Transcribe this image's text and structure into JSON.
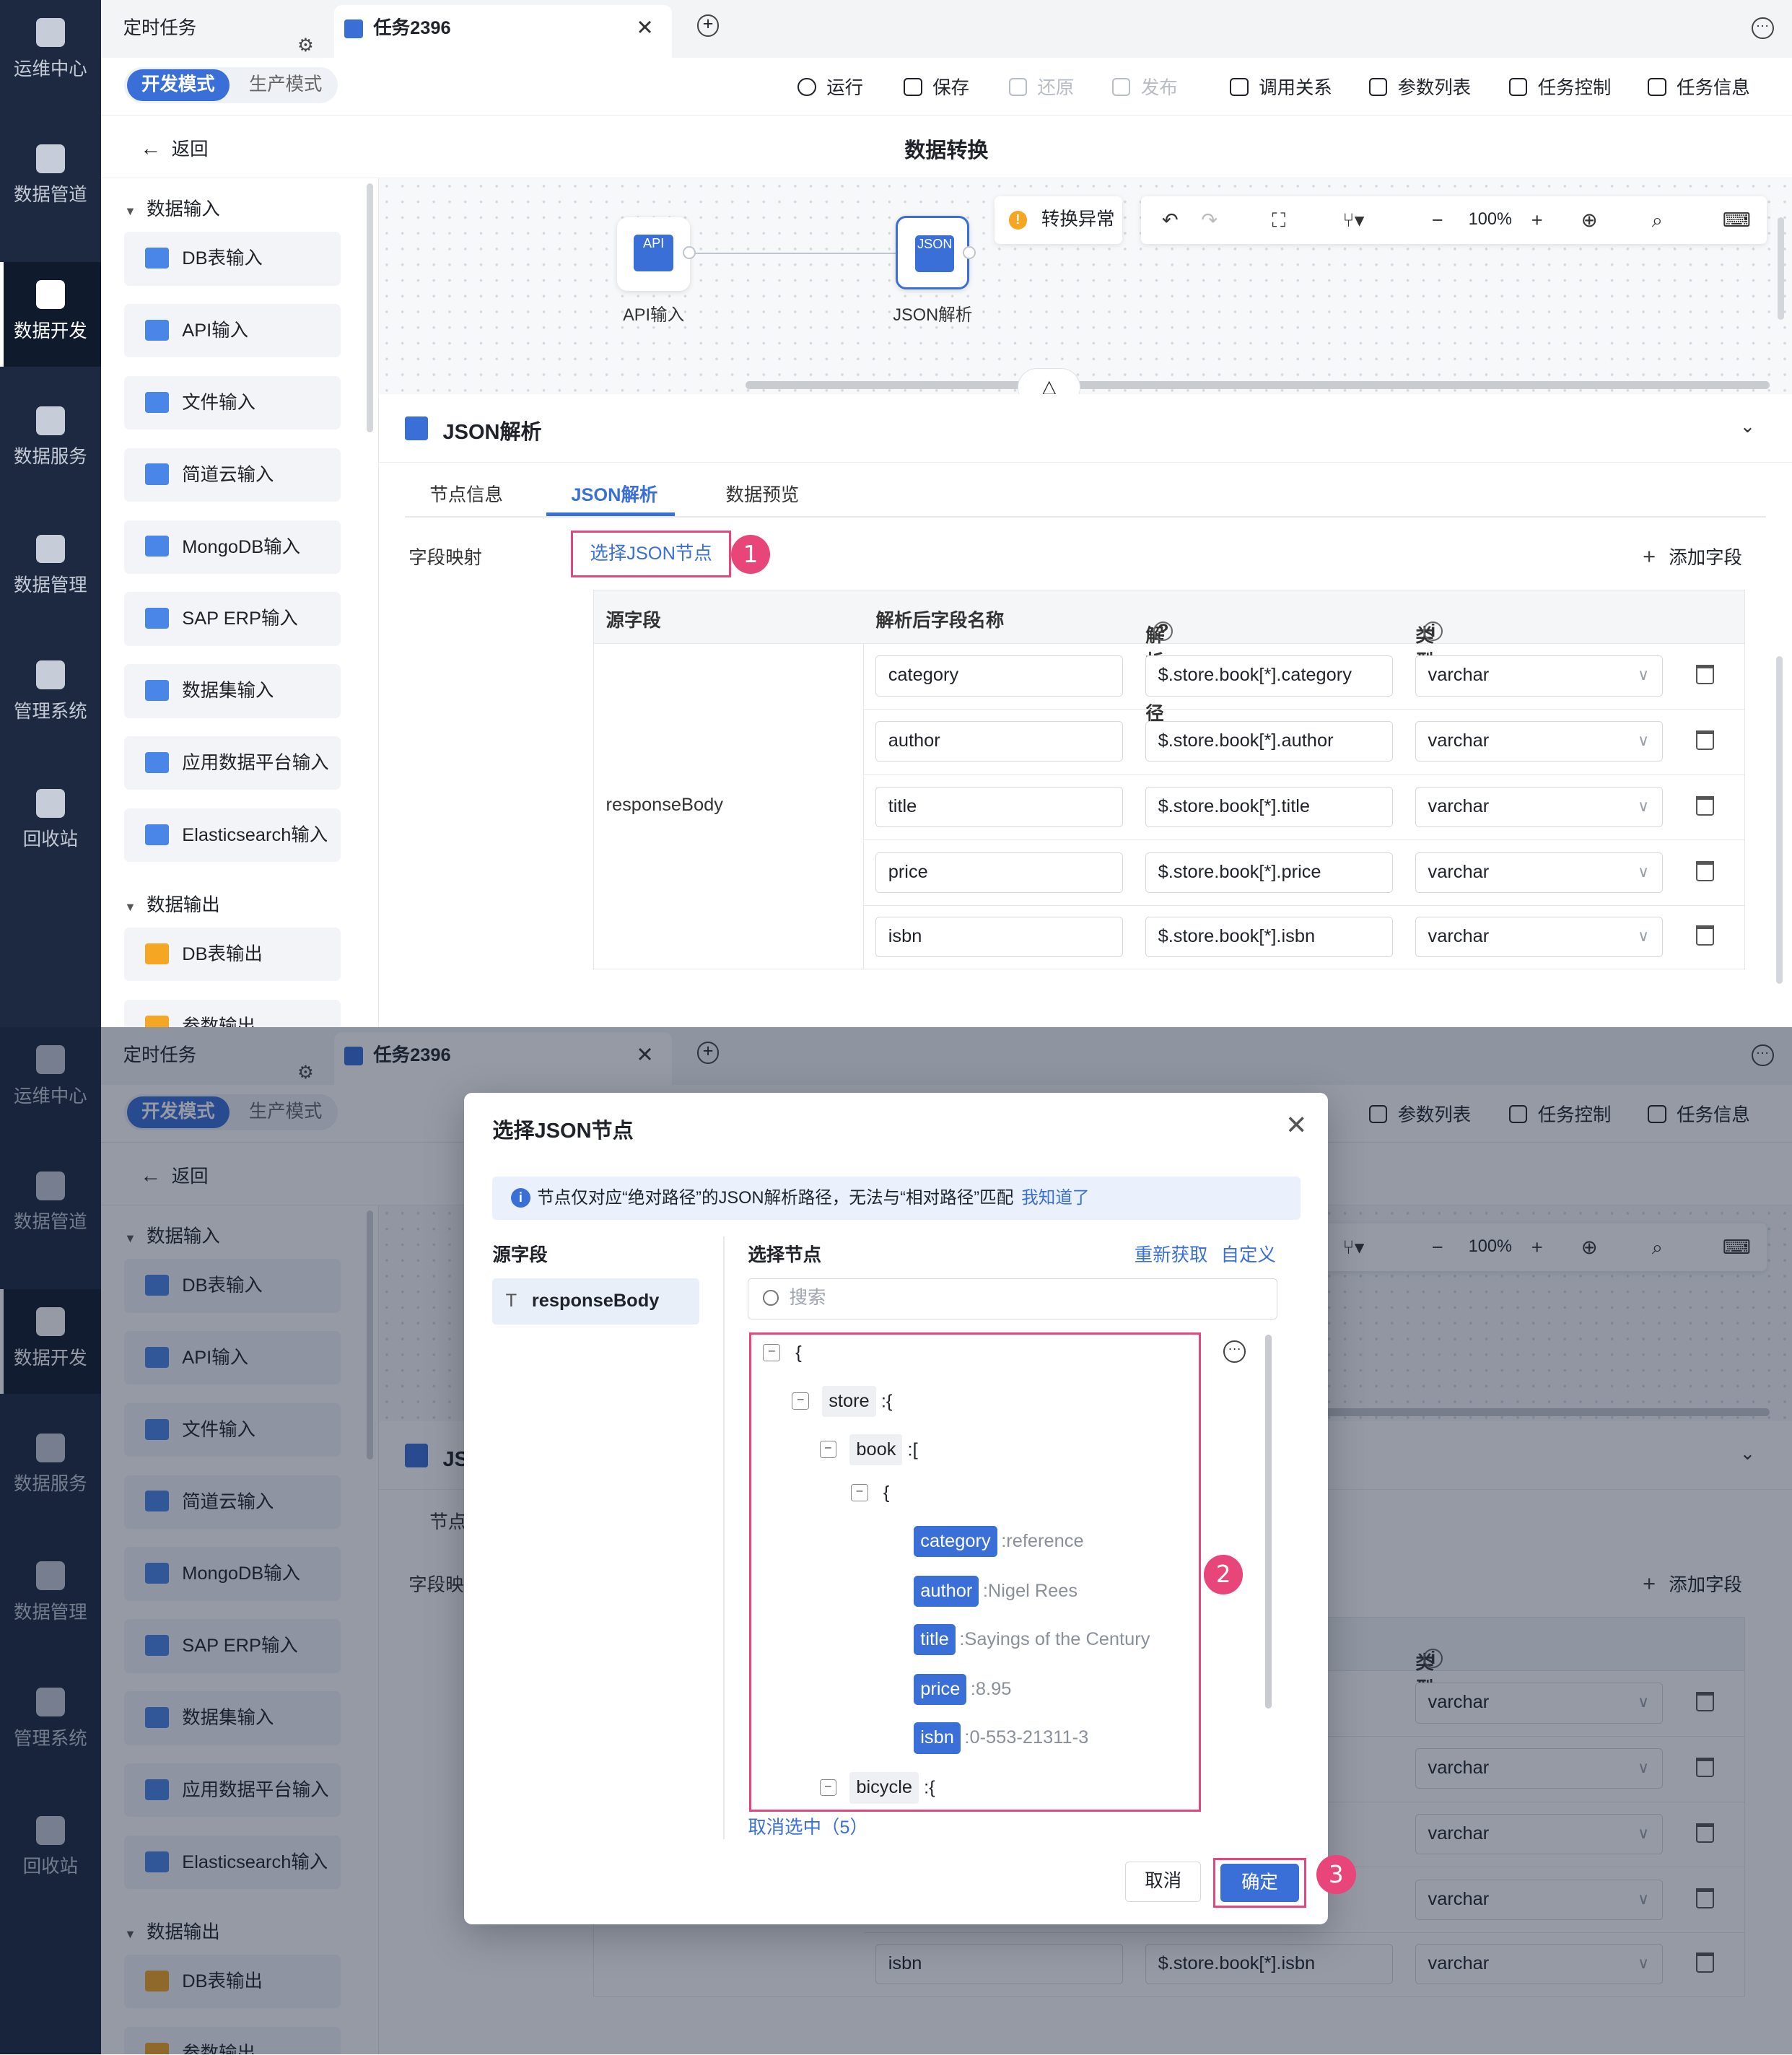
{
  "nav": [
    "运维中心",
    "数据管道",
    "数据开发",
    "数据服务",
    "数据管理",
    "管理系统",
    "回收站"
  ],
  "tabs": {
    "tab1": "定时任务",
    "tab2": "任务2396"
  },
  "mode": {
    "dev": "开发模式",
    "prod": "生产模式"
  },
  "toolbar": {
    "run": "运行",
    "save": "保存",
    "restore": "还原",
    "publish": "发布",
    "relation": "调用关系",
    "params": "参数列表",
    "control": "任务控制",
    "info": "任务信息"
  },
  "back": "返回",
  "page_title": "数据转换",
  "sidebar": {
    "input_group": "数据输入",
    "inputs": [
      "DB表输入",
      "API输入",
      "文件输入",
      "简道云输入",
      "MongoDB输入",
      "SAP ERP输入",
      "数据集输入",
      "应用数据平台输入",
      "Elasticsearch输入"
    ],
    "output_group": "数据输出",
    "outputs": [
      "DB表输出",
      "参数输出"
    ]
  },
  "canvas": {
    "node1": "API输入",
    "node1_icon": "API",
    "node2": "JSON解析",
    "node2_icon": "JSON",
    "warning": "转换异常",
    "zoom": "100%"
  },
  "panel": {
    "title": "JSON解析",
    "tabs": [
      "节点信息",
      "JSON解析",
      "数据预览"
    ],
    "field_mapping": "字段映射",
    "select_node_btn": "选择JSON节点",
    "add_field": "添加字段",
    "columns": [
      "源字段",
      "解析后字段名称",
      "解析路径",
      "类型"
    ],
    "source": "responseBody",
    "rows": [
      {
        "name": "category",
        "path": "$.store.book[*].category",
        "type": "varchar"
      },
      {
        "name": "author",
        "path": "$.store.book[*].author",
        "type": "varchar"
      },
      {
        "name": "title",
        "path": "$.store.book[*].title",
        "type": "varchar"
      },
      {
        "name": "price",
        "path": "$.store.book[*].price",
        "type": "varchar"
      },
      {
        "name": "isbn",
        "path": "$.store.book[*].isbn",
        "type": "varchar"
      }
    ]
  },
  "badges": [
    "1",
    "2",
    "3"
  ],
  "modal": {
    "title": "选择JSON节点",
    "info": "节点仅对应“绝对路径”的JSON解析路径，无法与“相对路径”匹配",
    "info_link": "我知道了",
    "src_header": "源字段",
    "src_item": "responseBody",
    "node_header": "选择节点",
    "refetch": "重新获取",
    "custom": "自定义",
    "search_placeholder": "搜索",
    "tree": {
      "open_brace": "{",
      "store": "store",
      "store_sep": ":{",
      "book": "book",
      "book_sep": ":[",
      "item_brace": "{",
      "fields": [
        {
          "key": "category",
          "val": "reference"
        },
        {
          "key": "author",
          "val": "Nigel Rees"
        },
        {
          "key": "title",
          "val": "Sayings of the Century"
        },
        {
          "key": "price",
          "val": "8.95"
        },
        {
          "key": "isbn",
          "val": "0-553-21311-3"
        }
      ],
      "bicycle": "bicycle",
      "bicycle_sep": ":{"
    },
    "unselect": "取消选中（5）",
    "cancel": "取消",
    "ok": "确定"
  },
  "colors": {
    "brand": "#3a6fd8",
    "highlight": "#e8467a",
    "nav_bg": "#1c2940",
    "warning": "#f5a623"
  }
}
